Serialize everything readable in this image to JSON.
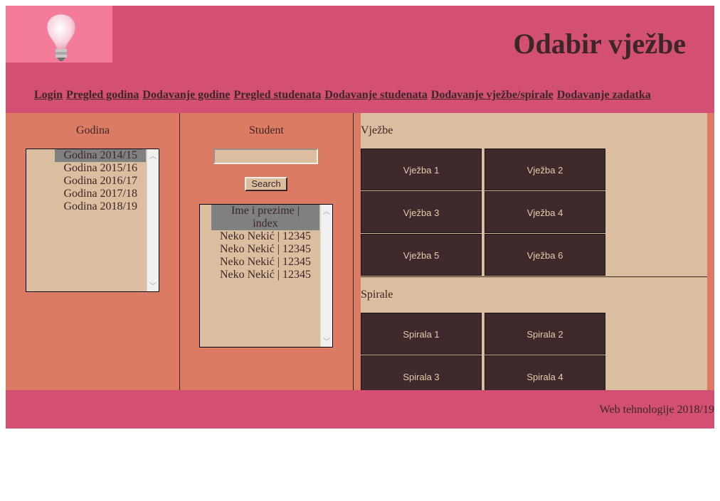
{
  "header": {
    "title": "Odabir vježbe",
    "logo_icon": "lightbulb-icon"
  },
  "nav": {
    "items": [
      "Login",
      "Pregled godina",
      "Dodavanje godine",
      "Pregled studenata",
      "Dodavanje studenata",
      "Dodavanje vježbe/spirale",
      "Dodavanje zadatka"
    ]
  },
  "godina": {
    "title": "Godina",
    "items": [
      "Godina 2014/15",
      "Godina 2015/16",
      "Godina 2016/17",
      "Godina 2017/18",
      "Godina 2018/19"
    ],
    "selected": "Godina 2014/15"
  },
  "student": {
    "title": "Student",
    "search_value": "",
    "search_label": "Search",
    "items": [
      "Ime i prezime |",
      "index",
      "Neko Nekić | 12345",
      "Neko Nekić | 12345",
      "Neko Nekić | 12345",
      "Neko Nekić | 12345"
    ]
  },
  "vjezbe": {
    "title": "Vježbe",
    "items": [
      "Vježba 1",
      "Vježba 2",
      "Vježba 3",
      "Vježba 4",
      "Vježba 5",
      "Vježba 6"
    ]
  },
  "spirale": {
    "title": "Spirale",
    "items": [
      "Spirala 1",
      "Spirala 2",
      "Spirala 3",
      "Spirala 4"
    ]
  },
  "footer": {
    "text": "Web tehnologije 2018/19"
  },
  "colors": {
    "header": "#d34f74",
    "main": "#dc7b64",
    "panel": "#dbbda0",
    "tile": "#3e2a2d",
    "text": "#3d2628",
    "logo_bg": "#f47a9a"
  }
}
